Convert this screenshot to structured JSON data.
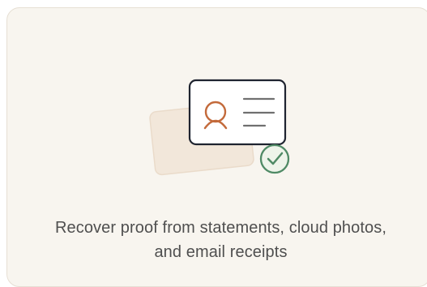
{
  "card": {
    "caption_line_1": "Recover proof from statements, cloud photos,",
    "caption_line_2": "and email receipts"
  },
  "icons": {
    "back_card": "back-document-card-icon",
    "id_card": "id-card-icon",
    "person": "person-avatar-icon",
    "text_lines": "text-lines-icon",
    "verified": "check-circle-icon"
  },
  "colors": {
    "card_background": "#f8f5ef",
    "card_border": "#e6dfd4",
    "back_card_fill": "#f2e7da",
    "id_card_outline": "#1f2430",
    "person_accent": "#c36a3b",
    "text_line_gray": "#707070",
    "check_green": "#4f8a65"
  }
}
